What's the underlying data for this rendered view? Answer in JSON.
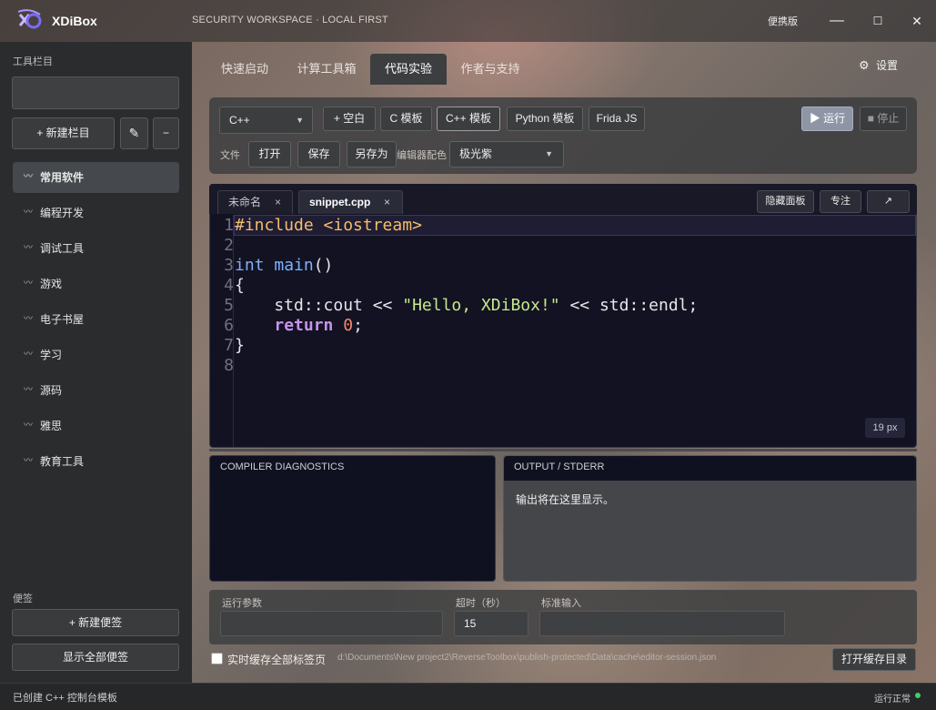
{
  "app": {
    "title": "XDiBox",
    "subtitle": "SECURITY WORKSPACE · LOCAL FIRST",
    "portable": "便携版",
    "minimize": "—",
    "maximize": "☐",
    "close": "✕"
  },
  "sidebar": {
    "toolbar_label": "工具栏目",
    "new_section": "+ 新建栏目",
    "edit_icon": "✎",
    "remove": "−",
    "items": [
      {
        "label": "常用软件",
        "active": true
      },
      {
        "label": "编程开发"
      },
      {
        "label": "调试工具"
      },
      {
        "label": "游戏"
      },
      {
        "label": "电子书屋"
      },
      {
        "label": "学习"
      },
      {
        "label": "源码"
      },
      {
        "label": "雅思"
      },
      {
        "label": "教育工具"
      }
    ],
    "notes_label": "便签",
    "new_note": "+ 新建便签",
    "show_all_notes": "显示全部便签"
  },
  "tabs": [
    {
      "label": "快速启动"
    },
    {
      "label": "计算工具箱"
    },
    {
      "label": "代码实验",
      "active": true
    },
    {
      "label": "作者与支持"
    }
  ],
  "settings_label": "设置",
  "toolbar": {
    "language": "C++",
    "templates": [
      "+ 空白",
      "C 模板",
      "C++ 模板",
      "Python 模板",
      "Frida JS"
    ],
    "run": "▶ 运行",
    "stop": "■ 停止",
    "file_label": "文件",
    "open": "打开",
    "save": "保存",
    "save_as": "另存为",
    "theme_label": "编辑器配色",
    "theme": "极光紫"
  },
  "editor": {
    "tabs": [
      {
        "label": "未命名",
        "close": "×"
      },
      {
        "label": "snippet.cpp",
        "close": "×",
        "active": true
      }
    ],
    "hide_panel": "隐藏面板",
    "focus": "专注",
    "expand": "↗",
    "font_size": "19 px",
    "line_numbers": [
      "1",
      "2",
      "3",
      "4",
      "5",
      "6",
      "7",
      "8"
    ],
    "code": {
      "l1": "#include <iostream>",
      "l3_kw": "int",
      "l3_fn": "main",
      "l3_rest": "()",
      "l4": "{",
      "l5_a": "    std::cout << ",
      "l5_str": "\"Hello, XDiBox!\"",
      "l5_b": " << std::endl;",
      "l6_indent": "    ",
      "l6_kw": "return",
      "l6_num": "0",
      "l6_end": ";",
      "l7": "}"
    }
  },
  "diagnostics": {
    "title": "COMPILER DIAGNOSTICS"
  },
  "output": {
    "title": "OUTPUT / STDERR",
    "text": "输出将在这里显示。"
  },
  "params": {
    "args_label": "运行参数",
    "args_value": "",
    "timeout_label": "超时（秒）",
    "timeout_value": "15",
    "stdin_label": "标准输入",
    "stdin_value": ""
  },
  "cache": {
    "checkbox_label": "实时缓存全部标签页",
    "path": "d:\\Documents\\New project2\\ReverseToolbox\\publish-protected\\Data\\cache\\editor-session.json",
    "open_dir": "打开缓存目录"
  },
  "status": {
    "left": "已创建 C++ 控制台模板",
    "right": "运行正常",
    "ok_color": "#3ecf6a"
  }
}
